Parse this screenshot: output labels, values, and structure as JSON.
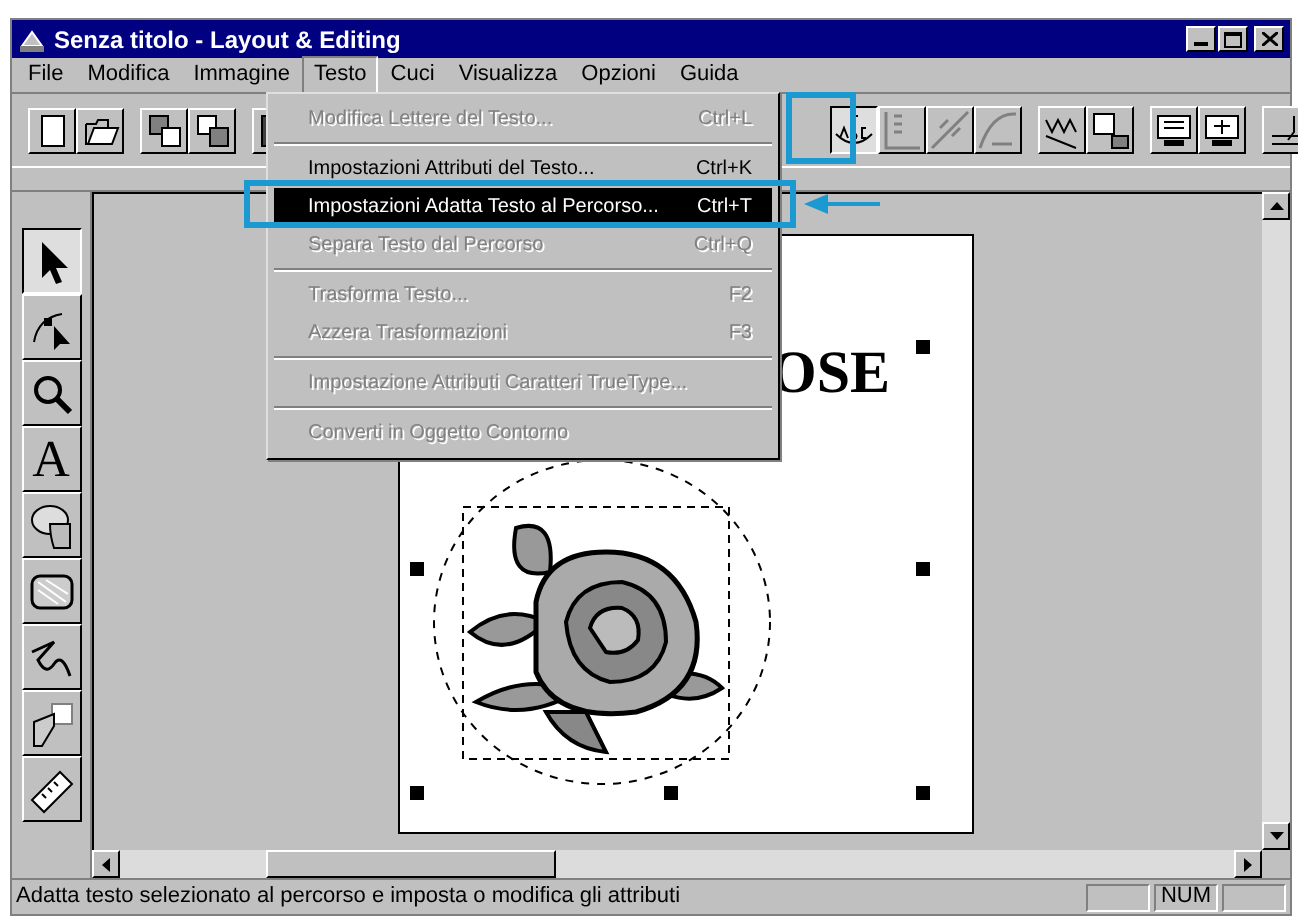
{
  "window": {
    "title": "Senza titolo - Layout & Editing"
  },
  "menubar": [
    {
      "label": "File",
      "selected": false
    },
    {
      "label": "Modifica",
      "selected": false
    },
    {
      "label": "Immagine",
      "selected": false
    },
    {
      "label": "Testo",
      "selected": true
    },
    {
      "label": "Cuci",
      "selected": false
    },
    {
      "label": "Visualizza",
      "selected": false
    },
    {
      "label": "Opzioni",
      "selected": false
    },
    {
      "label": "Guida",
      "selected": false
    }
  ],
  "menu": [
    {
      "kind": "item",
      "label": "Modifica Lettere del Testo...",
      "shortcut": "Ctrl+L",
      "disabled": true,
      "selected": false
    },
    {
      "kind": "separator"
    },
    {
      "kind": "item",
      "label": "Impostazioni Attributi del Testo...",
      "shortcut": "Ctrl+K",
      "disabled": false,
      "selected": false
    },
    {
      "kind": "item",
      "label": "Impostazioni Adatta Testo al Percorso...",
      "shortcut": "Ctrl+T",
      "disabled": false,
      "selected": true
    },
    {
      "kind": "item",
      "label": "Separa Testo dal Percorso",
      "shortcut": "Ctrl+Q",
      "disabled": true,
      "selected": false
    },
    {
      "kind": "separator"
    },
    {
      "kind": "item",
      "label": "Trasforma Testo...",
      "shortcut": "F2",
      "disabled": true,
      "selected": false
    },
    {
      "kind": "item",
      "label": "Azzera Trasformazioni",
      "shortcut": "F3",
      "disabled": true,
      "selected": false
    },
    {
      "kind": "separator"
    },
    {
      "kind": "item",
      "label": "Impostazione Attributi Caratteri TrueType...",
      "disabled": true,
      "selected": false
    },
    {
      "kind": "separator"
    },
    {
      "kind": "item",
      "label": "Converti in Oggetto Contorno",
      "disabled": true,
      "selected": false
    }
  ],
  "toolbar_right": [
    {
      "selected": true
    },
    {
      "selected": false
    },
    {
      "selected": false
    },
    {
      "selected": false
    },
    {
      "selected": false
    },
    {
      "selected": false
    },
    {
      "selected": false
    },
    {
      "selected": false
    },
    {
      "selected": false
    }
  ],
  "tools": [
    {
      "selected": true
    },
    {
      "selected": false
    },
    {
      "selected": false
    },
    {
      "selected": false,
      "label": "A"
    },
    {
      "selected": false
    },
    {
      "selected": false
    },
    {
      "selected": false
    },
    {
      "selected": false
    },
    {
      "selected": false
    }
  ],
  "canvas": {
    "text": "OSE"
  },
  "status_bar": {
    "message": "Adatta testo selezionato al percorso e imposta o modifica gli attributi",
    "panels": [
      {
        "kind": "blank"
      },
      {
        "kind": "text",
        "text": "NUM"
      },
      {
        "kind": "blank"
      }
    ]
  }
}
